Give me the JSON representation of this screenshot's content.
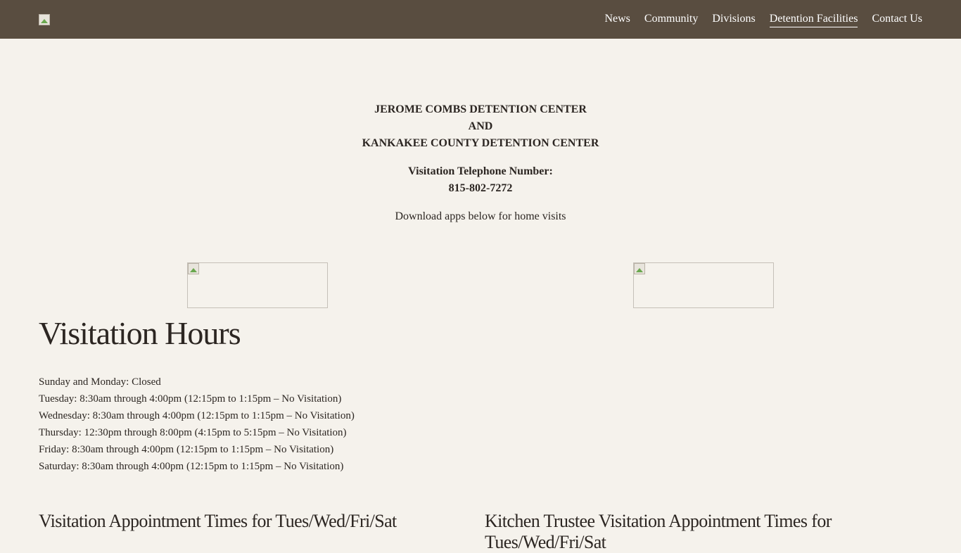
{
  "header": {
    "logo_alt": "",
    "nav": [
      {
        "label": "News",
        "active": false
      },
      {
        "label": "Community",
        "active": false
      },
      {
        "label": "Divisions",
        "active": false
      },
      {
        "label": "Detention Facilities",
        "active": true
      },
      {
        "label": "Contact Us",
        "active": false
      }
    ]
  },
  "intro": {
    "facility_line1": "JEROME COMBS DETENTION CENTER",
    "facility_line2": "AND",
    "facility_line3": "KANKAKEE COUNTY DETENTION CENTER",
    "phone_label": "Visitation Telephone Number:",
    "phone_number": "815-802-7272",
    "apps_note": "Download apps below for home visits"
  },
  "visitation": {
    "title": "Visitation Hours",
    "schedule": [
      "Sunday and Monday: Closed",
      "Tuesday: 8:30am through 4:00pm (12:15pm to 1:15pm – No Visitation)",
      "Wednesday: 8:30am through 4:00pm (12:15pm to 1:15pm – No Visitation)",
      "Thursday: 12:30pm through 8:00pm (4:15pm to 5:15pm – No Visitation)",
      "Friday: 8:30am through 4:00pm (12:15pm to 1:15pm – No Visitation)",
      "Saturday: 8:30am through 4:00pm (12:15pm to 1:15pm – No Visitation)"
    ]
  },
  "sections": {
    "appointment_times": "Visitation Appointment Times for Tues/Wed/Fri/Sat",
    "kitchen_trustee_line1": "Kitchen Trustee Visitation Appointment Times for",
    "kitchen_trustee_line2": "Tues/Wed/Fri/Sat"
  }
}
